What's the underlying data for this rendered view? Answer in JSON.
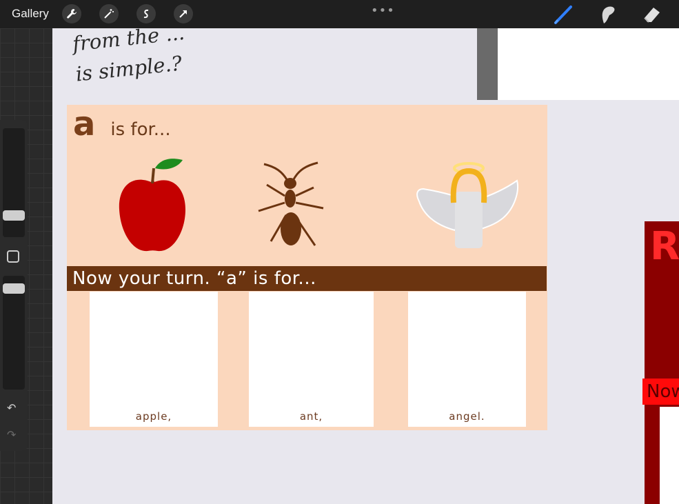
{
  "toolbar": {
    "gallery_label": "Gallery",
    "more_label": "•••",
    "left_tools": [
      "wrench-icon",
      "magic-wand-icon",
      "selection-icon",
      "transform-arrow-icon"
    ],
    "right_tools": [
      "brush-icon",
      "smudge-icon",
      "eraser-icon"
    ],
    "active_color": "#2f7fff"
  },
  "sidebar": {
    "undo_label": "↶",
    "redo_label": "↷"
  },
  "canvas": {
    "handwriting_line1": "from the ...",
    "handwriting_line2": "is simple.?",
    "card": {
      "letter": "a",
      "is_for": "is for...",
      "banner": "Now your turn. “a” is for...",
      "answers": [
        "apple,",
        "ant,",
        "angel."
      ]
    },
    "side_card": {
      "letter": "R",
      "banner": "Now"
    }
  }
}
